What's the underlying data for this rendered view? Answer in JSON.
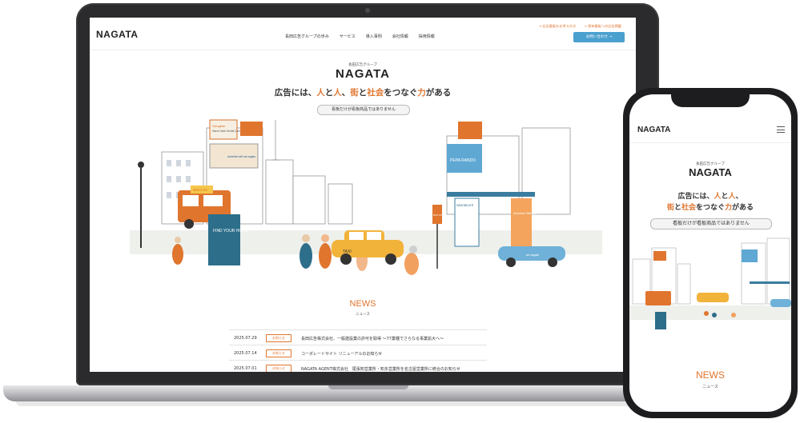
{
  "site": {
    "logo": "NAGATA",
    "nav": [
      "長田広告グループの歩み",
      "サービス",
      "導入事例",
      "会社情報",
      "採用情報"
    ],
    "top_links": [
      "→ 広告看板をお考えの方",
      "→ 保有看板への広告掲載"
    ],
    "contact_label": "お問い合わせ →"
  },
  "hero": {
    "group_label": "長田広告グループ",
    "brand": "NAGATA",
    "tagline": {
      "p1": "広告には、",
      "h1": "人",
      "p2": "と",
      "h2": "人",
      "p3": "、",
      "h3": "街",
      "p4": "と",
      "h4": "社会",
      "p5": "をつなぐ",
      "h5": "力",
      "p6": "がある"
    },
    "pill": "看板だけが看板商品ではありません"
  },
  "illustration": {
    "signs": [
      "Gangkan",
      "Warm Heart Dental Care",
      "WAH HA",
      "FIND YOUR HOME",
      "TAXI",
      "BUS STOP",
      "IMMOBILIER",
      "PEPA RANDO",
      "Advertise With Us",
      "ad nagata",
      "Advertise with ad nagata"
    ]
  },
  "news": {
    "title": "NEWS",
    "subtitle": "ニュース",
    "items": [
      {
        "date": "2025.07.29",
        "badge": "お知らせ",
        "text": "長田広告株式会社、一般建設業の許可を取得 〜77業種でさらなる事業拡大へ〜"
      },
      {
        "date": "2025.07.14",
        "badge": "お知らせ",
        "text": "コーポレートサイト リニューアルのお知らせ"
      },
      {
        "date": "2025.07.01",
        "badge": "お知らせ",
        "text": "NAGATA AGENT株式会社　尾張知営業所・知多営業所を名古屋営業所に統合のお知らせ"
      }
    ]
  },
  "mobile": {
    "logo": "NAGATA",
    "group_label": "長田広告グループ",
    "brand": "NAGATA",
    "line1": {
      "p1": "広告には、",
      "h1": "人",
      "p2": "と",
      "h2": "人",
      "p3": "、"
    },
    "line2": {
      "h1": "街",
      "p1": "と",
      "h2": "社会",
      "p2": "をつなぐ",
      "h3": "力",
      "p3": "がある"
    },
    "pill": "看板だけが看板商品ではありません",
    "news_title": "NEWS",
    "news_subtitle": "ニュース"
  },
  "colors": {
    "accent": "#e0752e",
    "contact_button": "#4aa0cf",
    "device": "#2b2b2e"
  }
}
